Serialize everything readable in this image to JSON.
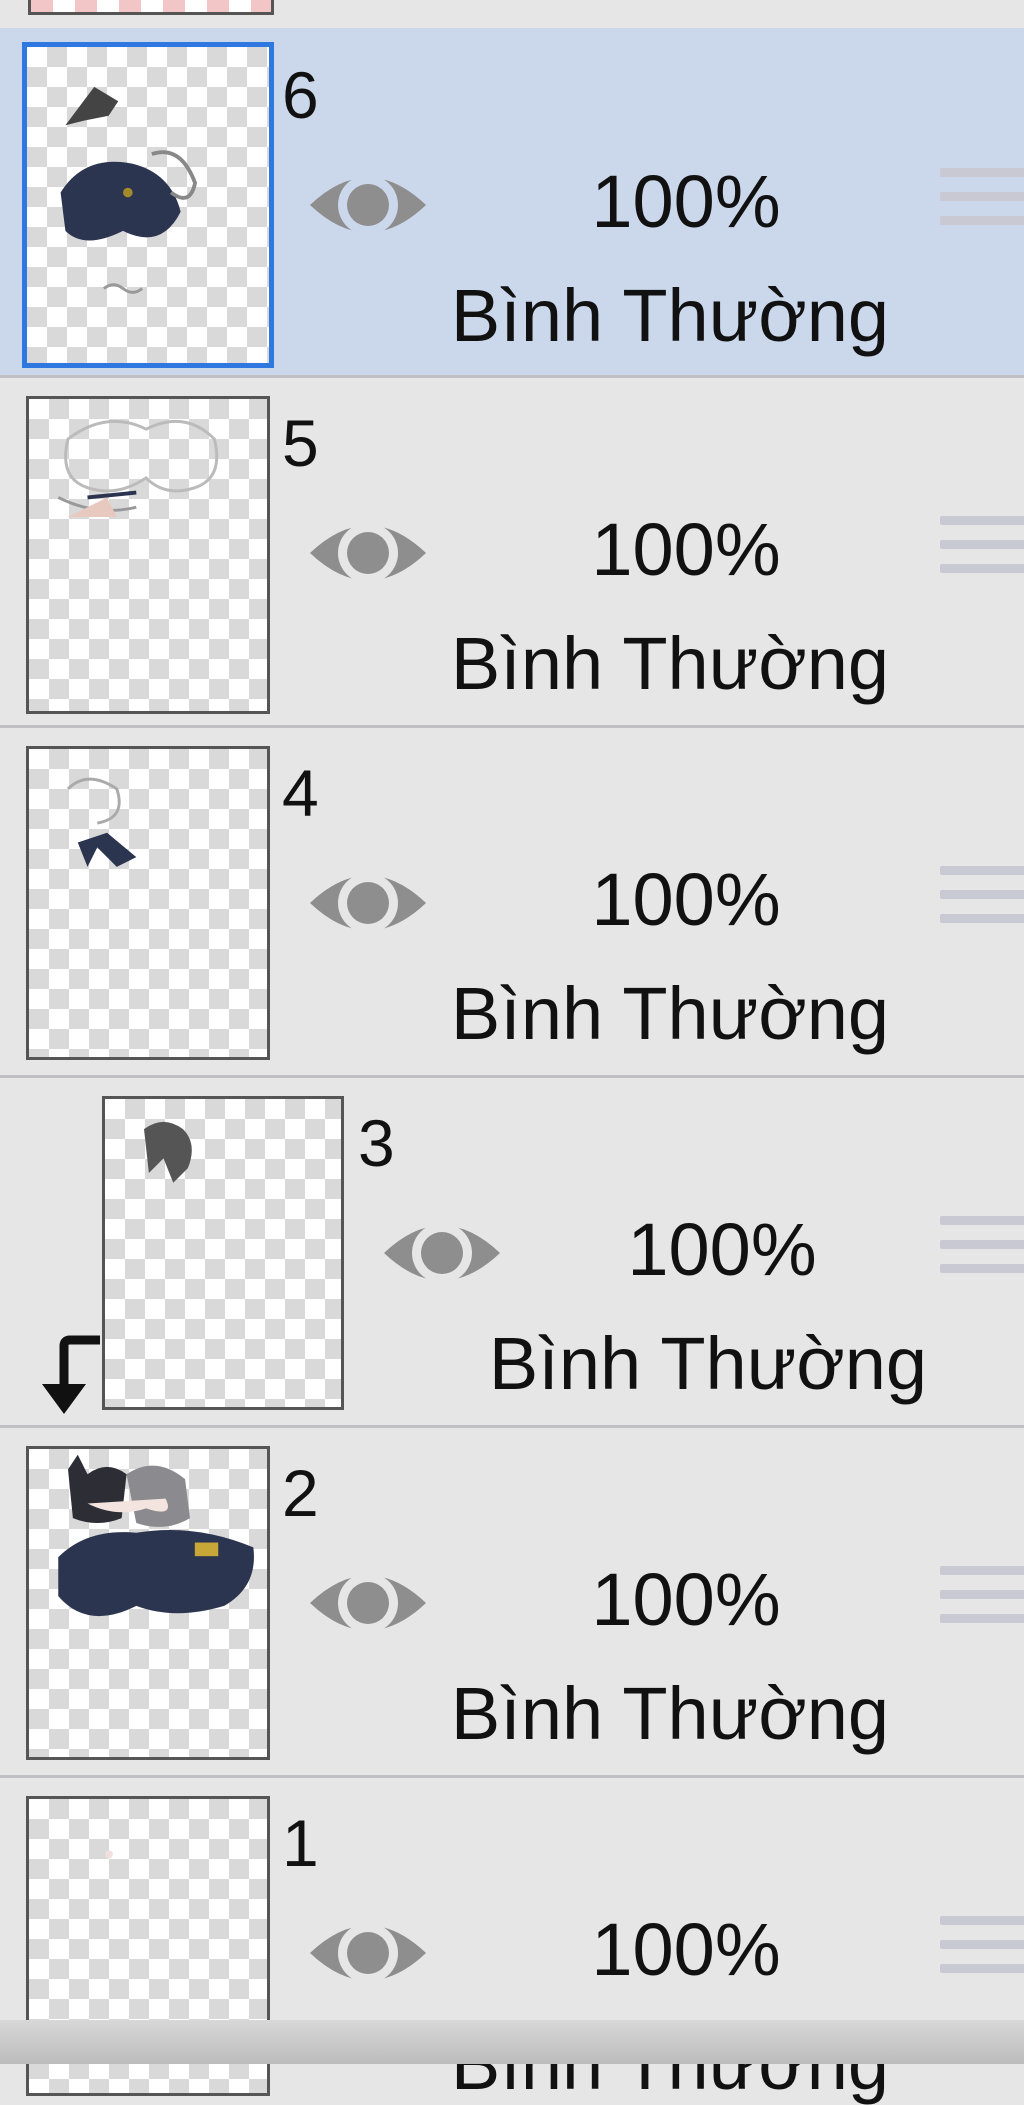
{
  "layers_panel": {
    "layers": [
      {
        "number": "6",
        "opacity": "100%",
        "blend_mode": "Bình Thường",
        "selected": true,
        "clipped": false
      },
      {
        "number": "5",
        "opacity": "100%",
        "blend_mode": "Bình Thường",
        "selected": false,
        "clipped": false
      },
      {
        "number": "4",
        "opacity": "100%",
        "blend_mode": "Bình Thường",
        "selected": false,
        "clipped": false
      },
      {
        "number": "3",
        "opacity": "100%",
        "blend_mode": "Bình Thường",
        "selected": false,
        "clipped": true
      },
      {
        "number": "2",
        "opacity": "100%",
        "blend_mode": "Bình Thường",
        "selected": false,
        "clipped": false
      },
      {
        "number": "1",
        "opacity": "100%",
        "blend_mode": "Bình Thường",
        "selected": false,
        "clipped": false
      }
    ],
    "icons": {
      "visibility": "eye-icon",
      "reorder": "drag-handle-icon",
      "clipping": "clipping-arrow-icon"
    },
    "colors": {
      "selected_row": "#cbd8ec",
      "selected_border": "#2f78e0",
      "row_background": "#e6e6e6",
      "eye": "#8e8e8e"
    }
  }
}
